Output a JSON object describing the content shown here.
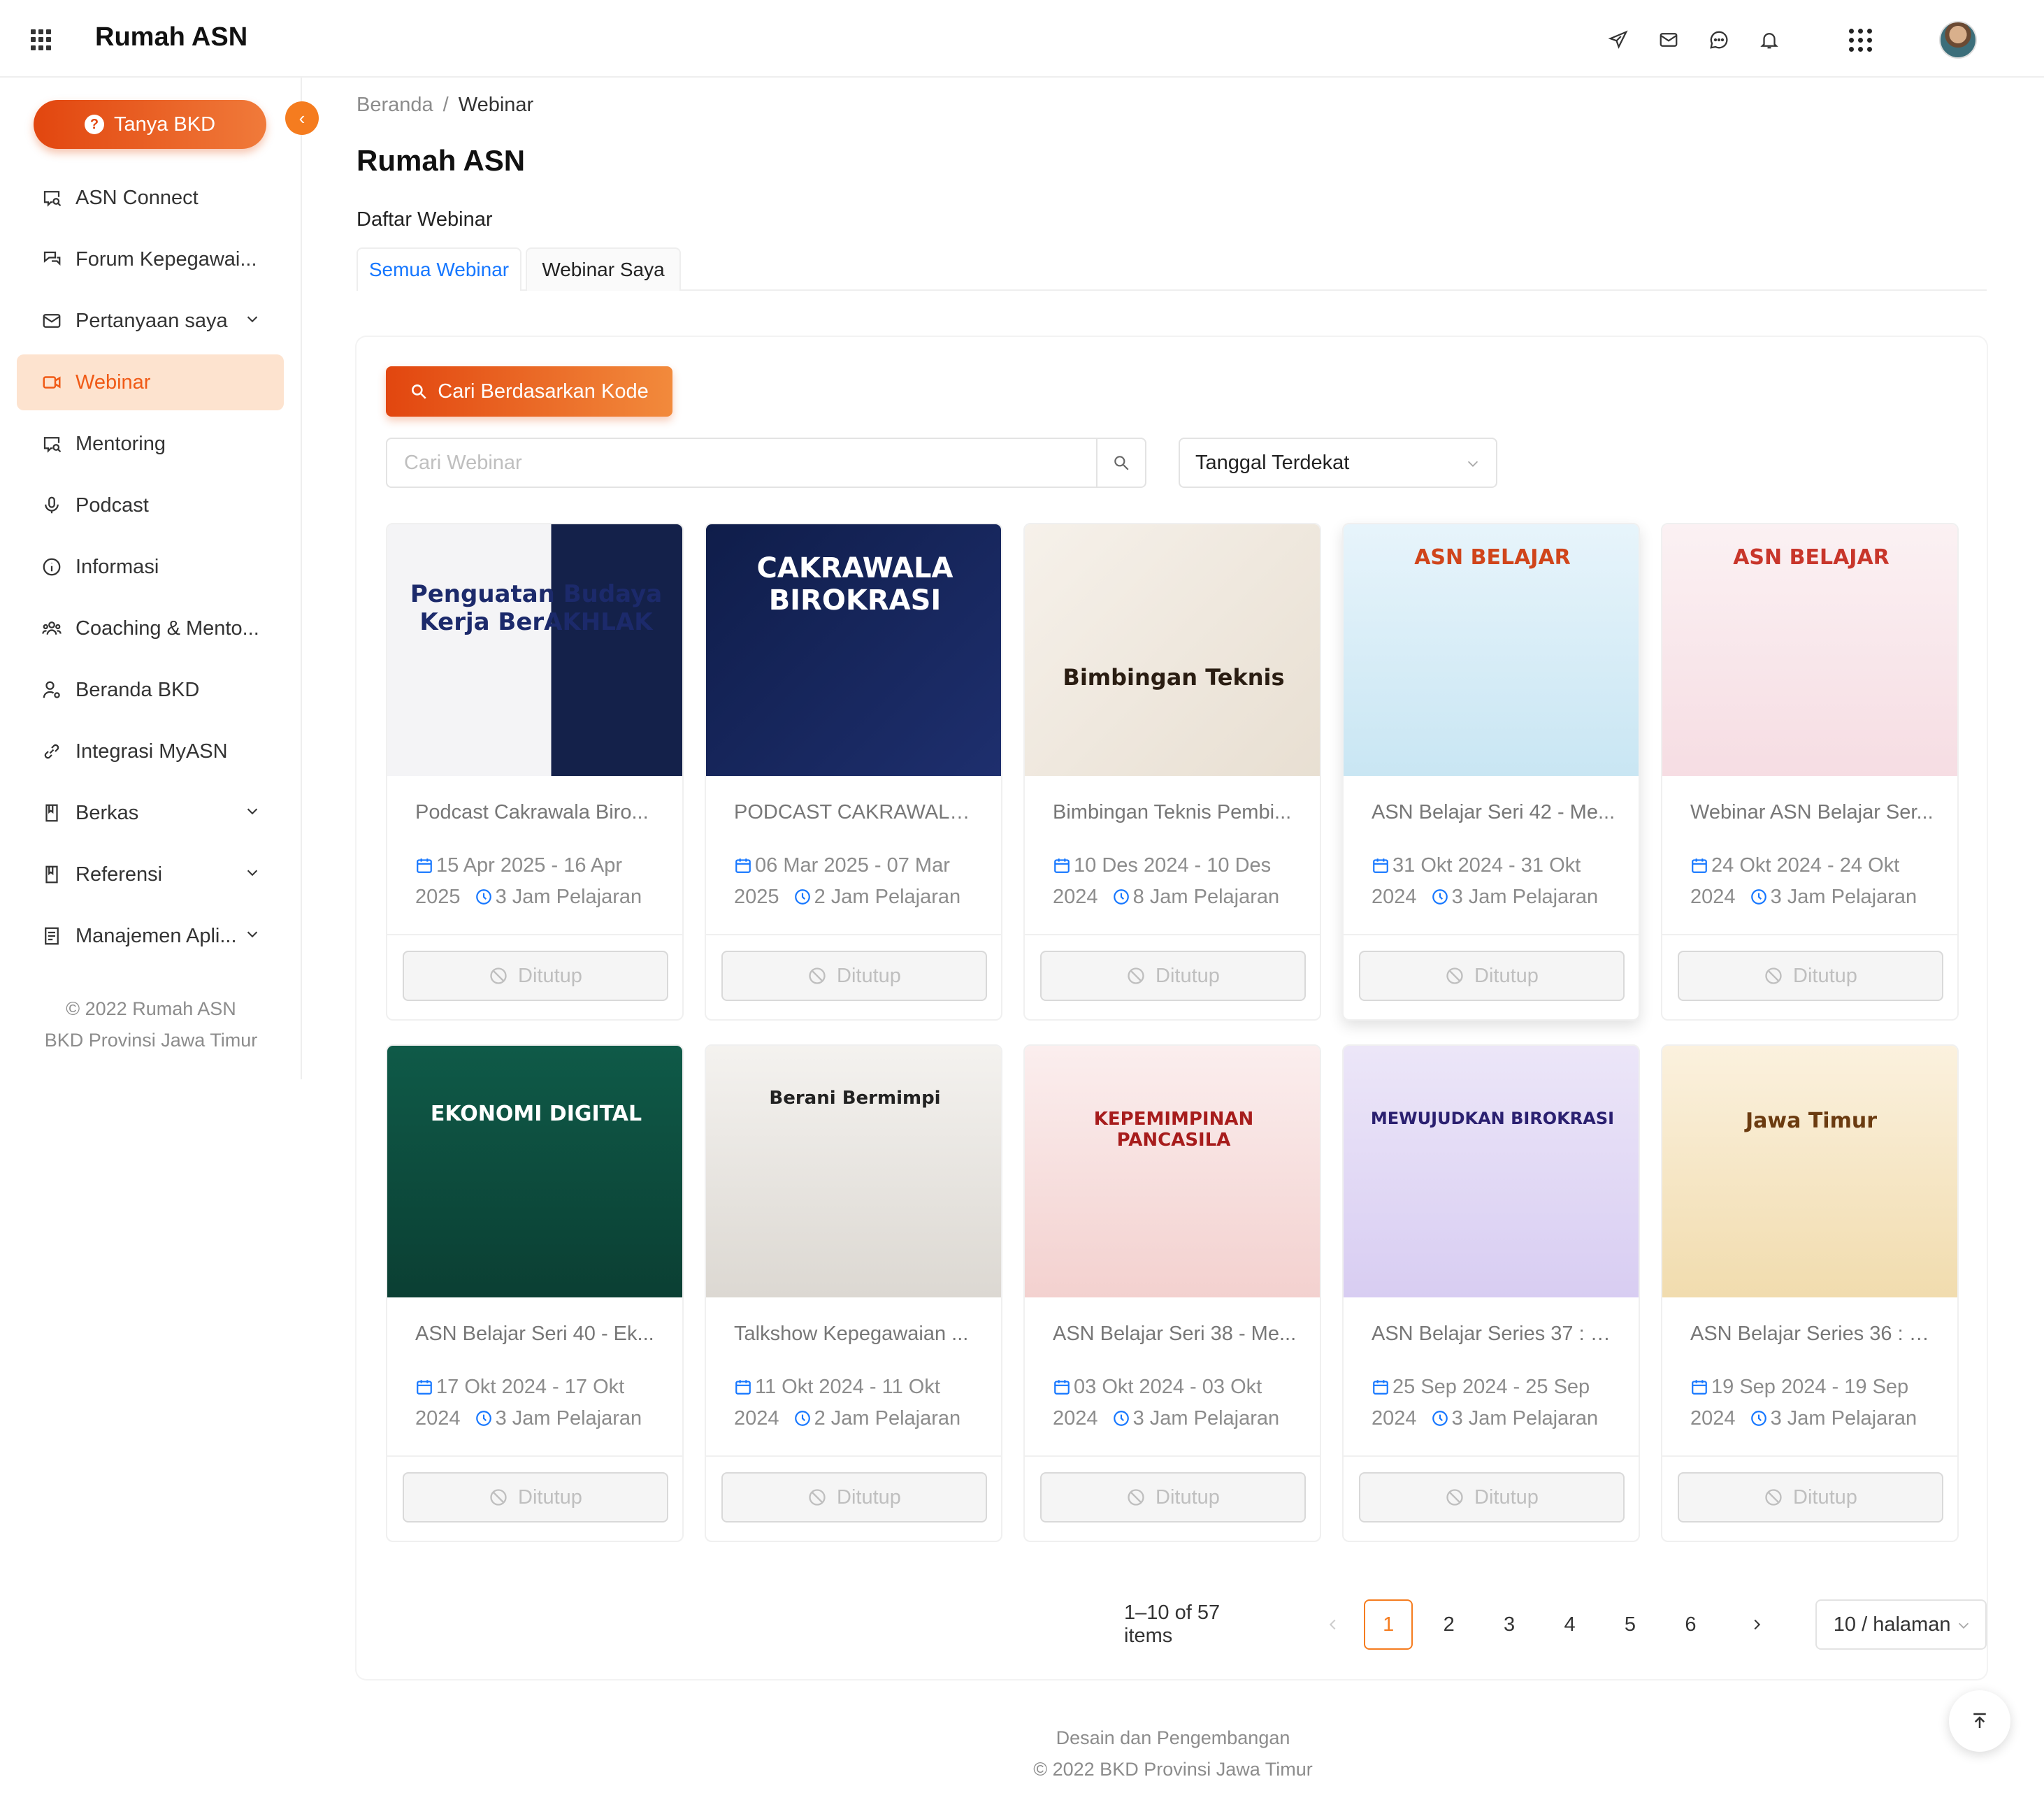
{
  "app": {
    "title": "Rumah ASN"
  },
  "sidebar": {
    "ask_button": "Tanya BKD",
    "items": [
      {
        "label": "ASN Connect",
        "icon": "chat-search-icon"
      },
      {
        "label": "Forum Kepegawai...",
        "icon": "forum-icon"
      },
      {
        "label": "Pertanyaan saya",
        "icon": "mail-icon"
      },
      {
        "label": "Webinar",
        "icon": "video-icon"
      },
      {
        "label": "Mentoring",
        "icon": "chat-search-icon"
      },
      {
        "label": "Podcast",
        "icon": "microphone-icon"
      },
      {
        "label": "Informasi",
        "icon": "info-icon"
      },
      {
        "label": "Coaching & Mento...",
        "icon": "users-icon"
      },
      {
        "label": "Beranda BKD",
        "icon": "user-settings-icon"
      },
      {
        "label": "Integrasi MyASN",
        "icon": "link-icon"
      },
      {
        "label": "Berkas",
        "icon": "book-icon"
      },
      {
        "label": "Referensi",
        "icon": "book-icon"
      },
      {
        "label": "Manajemen Apli...",
        "icon": "document-icon"
      }
    ],
    "footer_line1": "© 2022 Rumah ASN",
    "footer_line2": "BKD Provinsi Jawa Timur"
  },
  "breadcrumb": {
    "home": "Beranda",
    "separator": "/",
    "current": "Webinar"
  },
  "page": {
    "title": "Rumah ASN",
    "section": "Daftar Webinar"
  },
  "tabs": [
    {
      "label": "Semua Webinar"
    },
    {
      "label": "Webinar Saya"
    }
  ],
  "toolbar": {
    "code_button": "Cari Berdasarkan Kode",
    "search_placeholder": "Cari Webinar",
    "sort_value": "Tanggal Terdekat"
  },
  "webinars": [
    {
      "title": "Podcast Cakrawala Biro...",
      "date_start": "15 Apr 2025",
      "date_end": "16 Apr 2025",
      "hours": "3 Jam Pelajaran",
      "status": "Ditutup",
      "thumb_text": "Penguatan Budaya Kerja BerAKHLAK"
    },
    {
      "title": "PODCAST CAKRAWALA ...",
      "date_start": "06 Mar 2025",
      "date_end": "07 Mar 2025",
      "hours": "2 Jam Pelajaran",
      "status": "Ditutup",
      "thumb_text": "CAKRAWALA BIROKRASI"
    },
    {
      "title": "Bimbingan Teknis Pembi...",
      "date_start": "10 Des 2024",
      "date_end": "10 Des 2024",
      "hours": "8 Jam Pelajaran",
      "status": "Ditutup",
      "thumb_text": "Bimbingan Teknis"
    },
    {
      "title": "ASN Belajar Seri 42 - Me...",
      "date_start": "31 Okt 2024",
      "date_end": "31 Okt 2024",
      "hours": "3 Jam Pelajaran",
      "status": "Ditutup",
      "thumb_text": "ASN BELAJAR"
    },
    {
      "title": "Webinar ASN Belajar Ser...",
      "date_start": "24 Okt 2024",
      "date_end": "24 Okt 2024",
      "hours": "3 Jam Pelajaran",
      "status": "Ditutup",
      "thumb_text": "ASN BELAJAR"
    },
    {
      "title": "ASN Belajar Seri 40 - Ek...",
      "date_start": "17 Okt 2024",
      "date_end": "17 Okt 2024",
      "hours": "3 Jam Pelajaran",
      "status": "Ditutup",
      "thumb_text": "EKONOMI DIGITAL"
    },
    {
      "title": "Talkshow Kepegawaian ...",
      "date_start": "11 Okt 2024",
      "date_end": "11 Okt 2024",
      "hours": "2 Jam Pelajaran",
      "status": "Ditutup",
      "thumb_text": "Berani Bermimpi"
    },
    {
      "title": "ASN Belajar Seri 38 - Me...",
      "date_start": "03 Okt 2024",
      "date_end": "03 Okt 2024",
      "hours": "3 Jam Pelajaran",
      "status": "Ditutup",
      "thumb_text": "KEPEMIMPINAN PANCASILA"
    },
    {
      "title": "ASN Belajar Series 37 : M...",
      "date_start": "25 Sep 2024",
      "date_end": "25 Sep 2024",
      "hours": "3 Jam Pelajaran",
      "status": "Ditutup",
      "thumb_text": "MEWUJUDKAN BIROKRASI"
    },
    {
      "title": "ASN Belajar Series 36 : J...",
      "date_start": "19 Sep 2024",
      "date_end": "19 Sep 2024",
      "hours": "3 Jam Pelajaran",
      "status": "Ditutup",
      "thumb_text": "Jawa Timur"
    }
  ],
  "pagination": {
    "total_text": "1–10 of 57 items",
    "pages": [
      "1",
      "2",
      "3",
      "4",
      "5",
      "6"
    ],
    "current": 1,
    "page_size": "10 / halaman"
  },
  "footer": {
    "line1": "Desain dan Pengembangan",
    "line2": "© 2022 BKD Provinsi Jawa Timur"
  },
  "colors": {
    "accent": "#f57c1f",
    "accent_dark": "#e2460f",
    "link": "#1677ff",
    "active_bg": "#fde3cf"
  }
}
